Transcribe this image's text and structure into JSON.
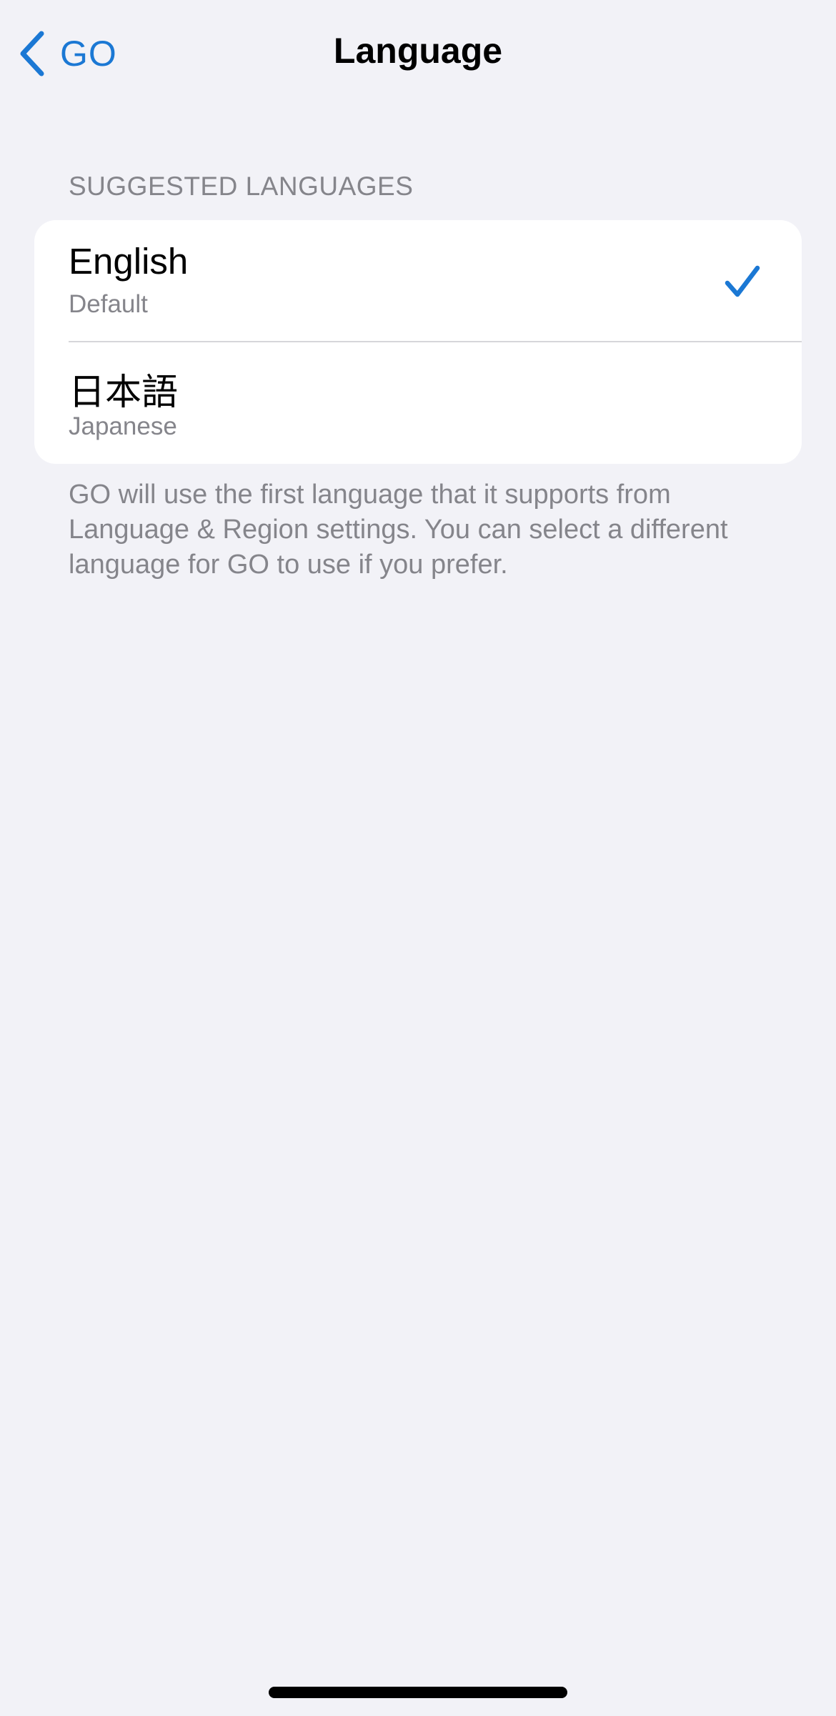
{
  "nav": {
    "back_label": "GO",
    "title": "Language"
  },
  "section": {
    "header": "SUGGESTED LANGUAGES",
    "items": [
      {
        "name": "English",
        "subtitle": "Default",
        "selected": true
      },
      {
        "name": "日本語",
        "subtitle": "Japanese",
        "selected": false
      }
    ]
  },
  "footer": {
    "text": "GO will use the first language that it supports from Language & Region settings. You can select a different language for GO to use if you prefer."
  },
  "icons": {
    "back": "chevron-left-icon",
    "selected": "checkmark-icon"
  },
  "colors": {
    "accent": "#1b78d4",
    "background": "#f2f2f7",
    "secondary_text": "#85858b"
  }
}
